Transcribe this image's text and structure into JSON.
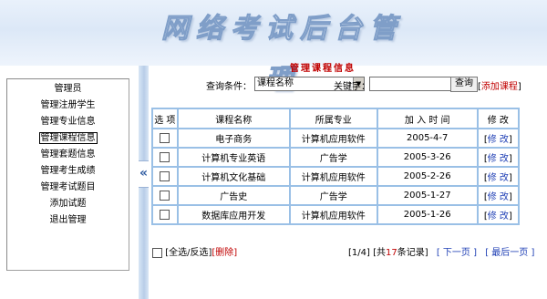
{
  "banner": {
    "title": "网络考试后台管理"
  },
  "sidebar": {
    "items": [
      {
        "label": "管理员",
        "active": false
      },
      {
        "label": "管理注册学生",
        "active": false
      },
      {
        "label": "管理专业信息",
        "active": false
      },
      {
        "label": "管理课程信息",
        "active": true
      },
      {
        "label": "管理套题信息",
        "active": false
      },
      {
        "label": "管理考生成绩",
        "active": false
      },
      {
        "label": "管理考试题目",
        "active": false
      },
      {
        "label": "添加试题",
        "active": false
      },
      {
        "label": "退出管理",
        "active": false
      }
    ],
    "collapse_icon": "double-chevron-left-icon"
  },
  "page": {
    "title": "管理课程信息"
  },
  "search": {
    "condition_label": "查询条件：",
    "condition_value": "课程名称",
    "keyword_label": "关键字：",
    "keyword_value": "",
    "button_label": "查询",
    "add_link_open": "[",
    "add_link_label": "添加课程",
    "add_link_close": "]"
  },
  "table": {
    "headers": [
      "选 项",
      "课程名称",
      "所属专业",
      "加 入 时 间",
      "修 改"
    ],
    "rows": [
      {
        "name": "电子商务",
        "major": "计算机应用软件",
        "date": "2005-4-7",
        "edit": "修 改"
      },
      {
        "name": "计算机专业英语",
        "major": "广告学",
        "date": "2005-3-26",
        "edit": "修 改"
      },
      {
        "name": "计算机文化基础",
        "major": "计算机应用软件",
        "date": "2005-2-26",
        "edit": "修 改"
      },
      {
        "name": "广告史",
        "major": "广告学",
        "date": "2005-1-27",
        "edit": "修 改"
      },
      {
        "name": "数据库应用开发",
        "major": "计算机应用软件",
        "date": "2005-1-26",
        "edit": "修 改"
      }
    ]
  },
  "footer": {
    "select_all_label": "[全选/反选]",
    "delete_label": "[删除]",
    "page_info": "[1/4]",
    "total_prefix": "[共",
    "total_count": "17",
    "total_suffix": "条记录]",
    "next_label": "[ 下一页 ]",
    "last_label": "[ 最后一页 ]"
  },
  "colors": {
    "accent_red": "#c00000",
    "link_blue": "#1f3fb5",
    "table_border": "#9ac0e6",
    "banner_bg": "#dce8f7"
  }
}
